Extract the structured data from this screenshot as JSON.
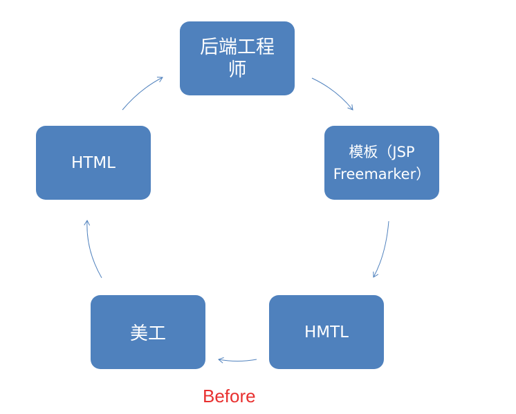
{
  "diagram": {
    "nodes": {
      "backend": {
        "label": "后端工程\n师"
      },
      "template": {
        "label": "模板（JSP\nFreemarker）"
      },
      "hmtl": {
        "label": "HMTL"
      },
      "designer": {
        "label": "美工"
      },
      "html": {
        "label": "HTML"
      }
    },
    "caption": "Before",
    "colors": {
      "node_fill": "#4f81bd",
      "node_text": "#ffffff",
      "arrow": "#4f81bd",
      "caption": "#e8302f"
    }
  }
}
